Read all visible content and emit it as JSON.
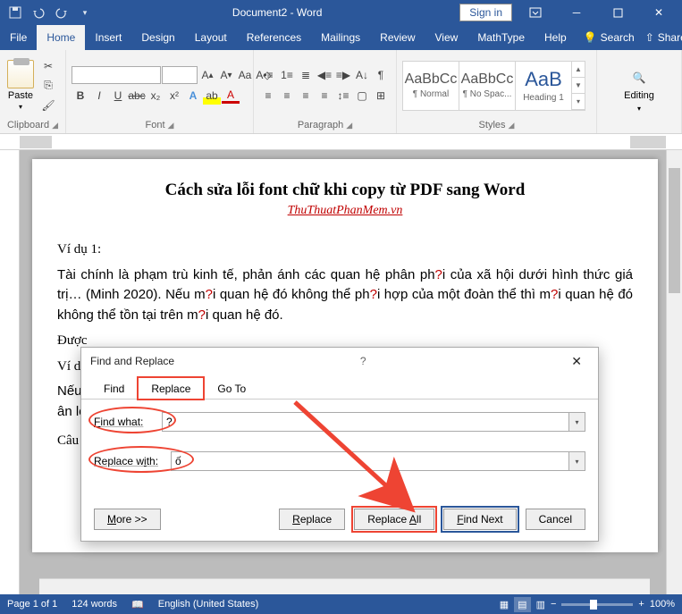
{
  "titlebar": {
    "title": "Document2 - Word",
    "signin": "Sign in"
  },
  "tabs": {
    "file": "File",
    "home": "Home",
    "insert": "Insert",
    "design": "Design",
    "layout": "Layout",
    "references": "References",
    "mailings": "Mailings",
    "review": "Review",
    "view": "View",
    "mathtype": "MathType",
    "help": "Help",
    "search": "Search",
    "share": "Share"
  },
  "ribbon": {
    "clipboard": {
      "label": "Clipboard",
      "paste": "Paste"
    },
    "font": {
      "label": "Font"
    },
    "paragraph": {
      "label": "Paragraph"
    },
    "styles": {
      "label": "Styles",
      "s1": {
        "preview": "AaBbCc",
        "name": "¶ Normal"
      },
      "s2": {
        "preview": "AaBbCc",
        "name": "¶ No Spac..."
      },
      "s3": {
        "preview": "AaB",
        "name": "Heading 1"
      }
    },
    "editing": {
      "label": "Editing"
    }
  },
  "document": {
    "title": "Cách sửa lỗi font chữ khi copy từ PDF sang Word",
    "subtitle": "ThuThuatPhanMem.vn",
    "p1": "Ví dụ 1:",
    "p2a": "Tài chính là phạm trù kinh tế, phản ánh các quan hệ phân ph",
    "p2b": "i của xã hội dưới hình thức giá trị… (Minh 2020). Nếu m",
    "p2c": "i quan hệ đó không thể ph",
    "p2d": "i hợp của một đoàn thể thì m",
    "p2e": "i quan hệ đó không thể tồn tại trên m",
    "p2f": "i quan hệ đó.",
    "q": "?",
    "p3": "Được",
    "p4": "Ví dụ",
    "p5a": "Nếu b",
    "p5b": "ân loại b",
    "p6": "Câu n"
  },
  "dialog": {
    "title": "Find and Replace",
    "tabs": {
      "find": "Find",
      "replace": "Replace",
      "goto": "Go To"
    },
    "find_label": "Find what:",
    "find_value": "?",
    "replace_label": "Replace with:",
    "replace_value": "ố",
    "more": "More >>",
    "replace": "Replace",
    "replace_all": "Replace All",
    "find_next": "Find Next",
    "cancel": "Cancel"
  },
  "statusbar": {
    "page": "Page 1 of 1",
    "words": "124 words",
    "lang": "English (United States)",
    "zoom": "100%"
  }
}
